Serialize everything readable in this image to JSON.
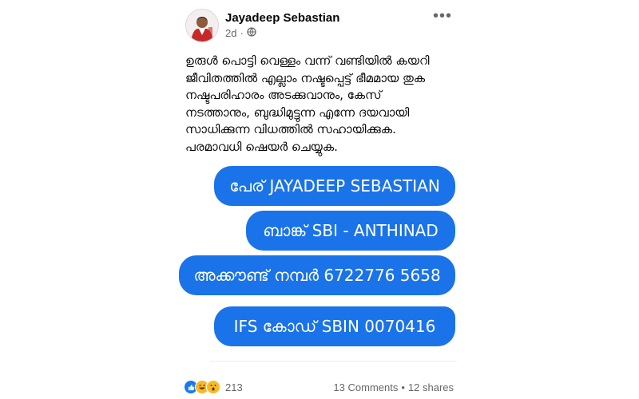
{
  "post": {
    "author": "Jayadeep Sebastian",
    "time": "2d",
    "privacy_icon": "globe-icon",
    "more_label": "•••",
    "text_lines": [
      "ഉരുൾ പൊട്ടി വെള്ളം വന്ന് വണ്ടിയിൽ കയറി",
      "ജീവിതത്തിൽ എല്ലാം നഷ്ടപ്പെട്ട് ഭീമമായ തുക",
      "നഷ്ടപരിഹാരം അടക്കുവാനും, കേസ്",
      "നടത്താനും, ബുദ്ധിമുട്ടുന്ന എന്നേ ദയവായി",
      "സാധിക്കുന്ന വിധത്തിൽ സഹായിക്കുക.",
      "പരമാവധി ഷെയർ ചെയ്യുക."
    ],
    "bubbles": [
      "പേര് JAYADEEP SEBASTIAN",
      "ബാങ്ക്   SBI - ANTHINAD",
      "അക്കൗണ്ട് നമ്പർ 6722776 5658",
      "IFS കോഡ് SBIN 0070416"
    ],
    "reaction_count": "213",
    "comments": "13 Comments",
    "separator": "•",
    "shares": "12 shares",
    "colors": {
      "bubble": "#1a73e8",
      "like": "#1877f2",
      "muted": "#65676b"
    }
  }
}
